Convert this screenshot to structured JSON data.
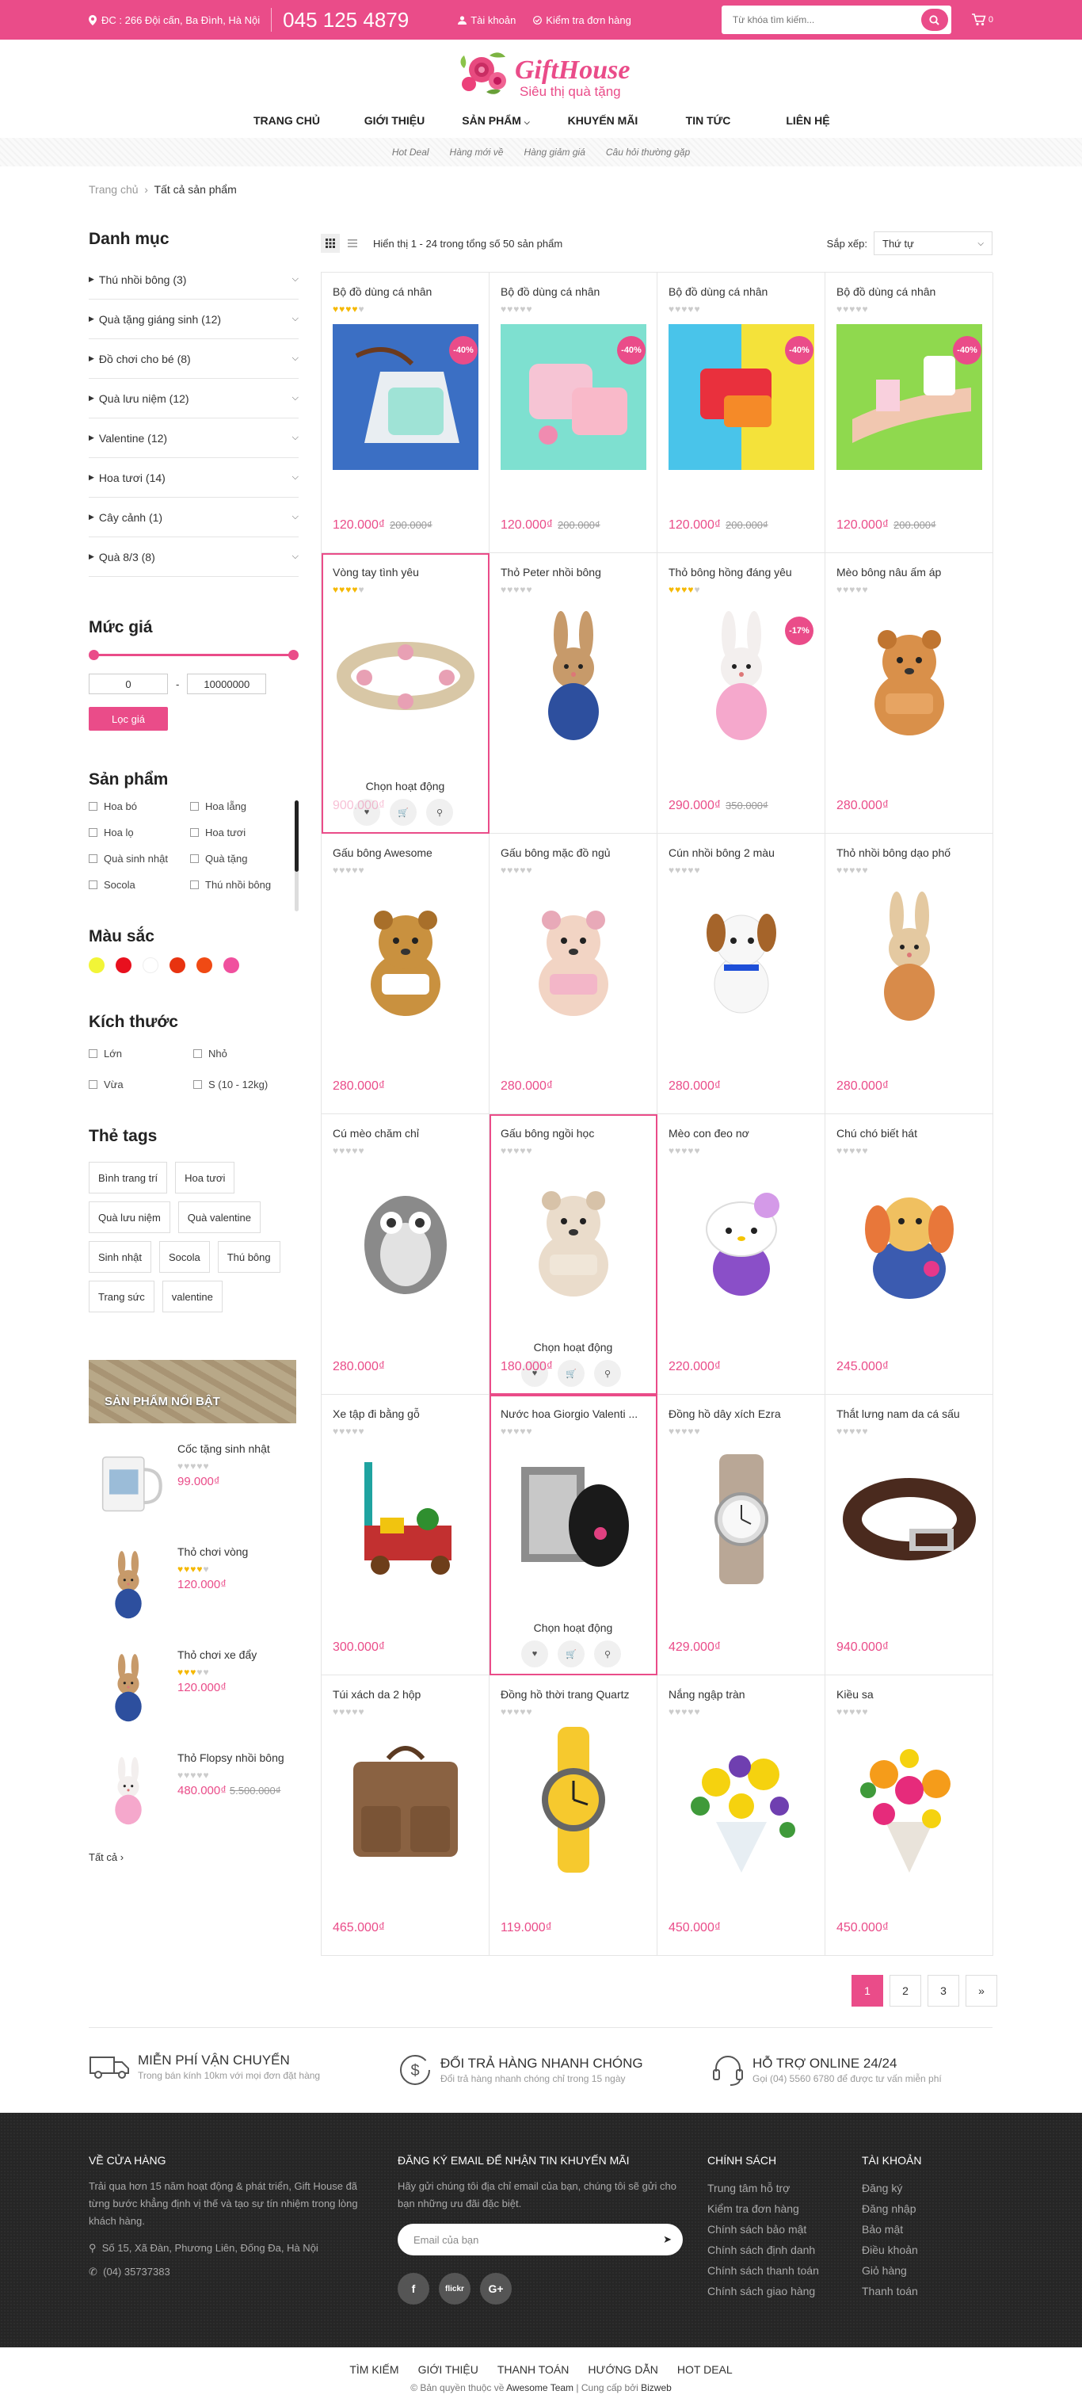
{
  "topbar": {
    "address": "ĐC : 266 Đội cấn, Ba Đình, Hà Nội",
    "phone": "045 125 4879",
    "account": "Tài khoản",
    "track_order": "Kiểm tra đơn hàng",
    "search_placeholder": "Từ khóa tìm kiếm...",
    "cart_count": "0"
  },
  "logo": {
    "title": "GiftHouse",
    "subtitle": "Siêu thị quà tặng"
  },
  "nav": [
    "TRANG CHỦ",
    "GIỚI THIỆU",
    "SẢN PHẨM",
    "KHUYẾN MÃI",
    "TIN TỨC",
    "LIÊN HỆ"
  ],
  "subnav": [
    "Hot Deal",
    "Hàng mới về",
    "Hàng giảm giá",
    "Câu hỏi thường gặp"
  ],
  "breadcrumb": {
    "home": "Trang chủ",
    "current": "Tất cả sản phẩm"
  },
  "sidebar": {
    "categories_title": "Danh mục",
    "categories": [
      "Thú nhồi bông (3)",
      "Quà tặng giáng sinh (12)",
      "Đồ chơi cho bé (8)",
      "Quà lưu niệm (12)",
      "Valentine (12)",
      "Hoa tươi (14)",
      "Cây cảnh (1)",
      "Quà 8/3 (8)"
    ],
    "price_title": "Mức giá",
    "price_min": "0",
    "price_max": "10000000",
    "filter_button": "Lọc giá",
    "products_title": "Sản phẩm",
    "product_filters": [
      "Hoa bó",
      "Hoa lẵng",
      "Hoa lọ",
      "Hoa tươi",
      "Quà sinh nhật",
      "Quà tặng",
      "Socola",
      "Thú nhồi bông"
    ],
    "colors_title": "Màu sắc",
    "colors": [
      "#f2f537",
      "#e8101e",
      "#ffffff",
      "#e83310",
      "#f04a14",
      "#f0509e"
    ],
    "sizes_title": "Kích thước",
    "sizes": [
      "Lớn",
      "Nhỏ",
      "Vừa",
      "S (10 - 12kg)"
    ],
    "tags_title": "Thẻ tags",
    "tags": [
      "Bình trang trí",
      "Hoa tươi",
      "Quà lưu niệm",
      "Quà valentine",
      "Sinh nhật",
      "Socola",
      "Thú bông",
      "Trang sức",
      "valentine"
    ],
    "featured_title": "SẢN PHẨM NỔI BẬT",
    "featured": [
      {
        "name": "Cốc tặng sinh nhật",
        "price": "99.000₫",
        "old": "",
        "stars": 0
      },
      {
        "name": "Thỏ chơi vòng",
        "price": "120.000₫",
        "old": "",
        "stars": 4
      },
      {
        "name": "Thỏ chơi xe đẩy",
        "price": "120.000₫",
        "old": "",
        "stars": 3
      },
      {
        "name": "Thỏ Flopsy nhồi bông",
        "price": "480.000₫",
        "old": "5.500.000₫",
        "stars": 0
      }
    ],
    "see_all": "Tất cả ›"
  },
  "toolbar": {
    "showing": "Hiển thị 1 - 24 trong tổng số 50 sản phẩm",
    "sort_label": "Sắp xếp:",
    "sort_value": "Thứ tự"
  },
  "products": [
    {
      "name": "Bộ đồ dùng cá nhân",
      "price": "120.000₫",
      "old": "200.000₫",
      "badge": "-40%",
      "stars": 4,
      "art": "pouch1",
      "hl": false
    },
    {
      "name": "Bộ đồ dùng cá nhân",
      "price": "120.000₫",
      "old": "200.000₫",
      "badge": "-40%",
      "stars": 0,
      "art": "pouch2",
      "hl": false
    },
    {
      "name": "Bộ đồ dùng cá nhân",
      "price": "120.000₫",
      "old": "200.000₫",
      "badge": "-40%",
      "stars": 0,
      "art": "pouch3",
      "hl": false
    },
    {
      "name": "Bộ đồ dùng cá nhân",
      "price": "120.000₫",
      "old": "200.000₫",
      "badge": "-40%",
      "stars": 0,
      "art": "pouch4",
      "hl": false
    },
    {
      "name": "Vòng tay tình yêu",
      "price": "900.000₫",
      "old": "",
      "badge": "",
      "stars": 4,
      "art": "bracelet",
      "hl": true
    },
    {
      "name": "Thỏ Peter nhồi bông",
      "price": "",
      "old": "",
      "badge": "",
      "stars": 0,
      "art": "rabbit-blue",
      "hl": false
    },
    {
      "name": "Thỏ bông hồng đáng yêu",
      "price": "290.000₫",
      "old": "350.000₫",
      "badge": "-17%",
      "stars": 4,
      "art": "rabbit-pink",
      "hl": false
    },
    {
      "name": "Mèo bông nâu ấm áp",
      "price": "280.000₫",
      "old": "",
      "badge": "",
      "stars": 0,
      "art": "cat-brown",
      "hl": false
    },
    {
      "name": "Gấu bông Awesome",
      "price": "280.000₫",
      "old": "",
      "badge": "",
      "stars": 0,
      "art": "bear-beatles",
      "hl": false
    },
    {
      "name": "Gấu bông mặc đồ ngủ",
      "price": "280.000₫",
      "old": "",
      "badge": "",
      "stars": 0,
      "art": "bear-pink",
      "hl": false
    },
    {
      "name": "Cún nhồi bông 2 màu",
      "price": "280.000₫",
      "old": "",
      "badge": "",
      "stars": 0,
      "art": "dog",
      "hl": false
    },
    {
      "name": "Thỏ nhồi bông dạo phố",
      "price": "280.000₫",
      "old": "",
      "badge": "",
      "stars": 0,
      "art": "rabbit-scarf",
      "hl": false
    },
    {
      "name": "Cú mèo chăm chỉ",
      "price": "280.000₫",
      "old": "",
      "badge": "",
      "stars": 0,
      "art": "owl",
      "hl": false
    },
    {
      "name": "Gấu bông ngồi học",
      "price": "180.000₫",
      "old": "",
      "badge": "",
      "stars": 0,
      "art": "bear-cream",
      "hl": true
    },
    {
      "name": "Mèo con đeo nơ",
      "price": "220.000₫",
      "old": "",
      "badge": "",
      "stars": 0,
      "art": "kitty",
      "hl": false
    },
    {
      "name": "Chú chó biết hát",
      "price": "245.000₫",
      "old": "",
      "badge": "",
      "stars": 0,
      "art": "puppy",
      "hl": false
    },
    {
      "name": "Xe tập đi bằng gỗ",
      "price": "300.000₫",
      "old": "",
      "badge": "",
      "stars": 0,
      "art": "walker",
      "hl": false
    },
    {
      "name": "Nước hoa Giorgio Valenti ...",
      "price": "",
      "old": "",
      "badge": "",
      "stars": 0,
      "art": "perfume",
      "hl": true
    },
    {
      "name": "Đồng hồ dây xích Ezra",
      "price": "429.000₫",
      "old": "",
      "badge": "",
      "stars": 0,
      "art": "watch-wrap",
      "hl": false
    },
    {
      "name": "Thắt lưng nam da cá sấu",
      "price": "940.000₫",
      "old": "",
      "badge": "",
      "stars": 0,
      "art": "belt",
      "hl": false
    },
    {
      "name": "Túi xách da 2 hộp",
      "price": "465.000₫",
      "old": "",
      "badge": "",
      "stars": 0,
      "art": "bag",
      "hl": false
    },
    {
      "name": "Đồng hồ thời trang Quartz",
      "price": "119.000₫",
      "old": "",
      "badge": "",
      "stars": 0,
      "art": "watch-yellow",
      "hl": false
    },
    {
      "name": "Nắng ngập tràn",
      "price": "450.000₫",
      "old": "",
      "badge": "",
      "stars": 0,
      "art": "flowers1",
      "hl": false
    },
    {
      "name": "Kiều sa",
      "price": "450.000₫",
      "old": "",
      "badge": "",
      "stars": 0,
      "art": "flowers2",
      "hl": false
    }
  ],
  "hover_label": "Chọn hoạt động",
  "pagination": [
    "1",
    "2",
    "3",
    "»"
  ],
  "services": [
    {
      "title": "MIỄN PHÍ VẬN CHUYỂN",
      "desc": "Trong bán kính 10km với mọi đơn đặt hàng",
      "icon": "truck-icon"
    },
    {
      "title": "ĐỔI TRẢ HÀNG NHANH CHÓNG",
      "desc": "Đổi trả hàng nhanh chóng chỉ trong 15 ngày",
      "icon": "dollar-icon"
    },
    {
      "title": "HỖ TRỢ ONLINE 24/24",
      "desc": "Gọi (04) 5560 6780 để được tư vấn miễn phí",
      "icon": "headset-icon"
    }
  ],
  "footer": {
    "about_title": "VỀ CỬA HÀNG",
    "about_text": "Trải qua hơn 15 năm hoạt động & phát triển, Gift House đã từng bước khẳng định vị thế và tạo sự tín nhiệm trong lòng khách hàng.",
    "address": "Số 15, Xã Đàn, Phương Liên, Đống Đa, Hà Nội",
    "phone": "(04) 35737383",
    "newsletter_title": "ĐĂNG KÝ EMAIL ĐỂ NHẬN TIN KHUYẾN MÃI",
    "newsletter_text": "Hãy gửi chúng tôi địa chỉ email của bạn, chúng tôi sẽ gửi cho bạn những ưu đãi đặc biệt.",
    "email_placeholder": "Email của bạn",
    "socials": [
      "f",
      "flickr",
      "G+"
    ],
    "policy_title": "CHÍNH SÁCH",
    "policy_links": [
      "Trung tâm hỗ trợ",
      "Kiểm tra đơn hàng",
      "Chính sách bảo mật",
      "Chính sách định danh",
      "Chính sách thanh toán",
      "Chính sách giao hàng"
    ],
    "account_title": "TÀI KHOẢN",
    "account_links": [
      "Đăng ký",
      "Đăng nhập",
      "Bảo mật",
      "Điều khoản",
      "Giỏ hàng",
      "Thanh toán"
    ]
  },
  "bottom": {
    "nav": [
      "TÌM KIẾM",
      "GIỚI THIỆU",
      "THANH TOÁN",
      "HƯỚNG DẪN",
      "HOT DEAL"
    ],
    "copy_prefix": "© Bản quyền thuộc về",
    "copy_team": "Awesome Team",
    "copy_mid": "| Cung cấp bởi",
    "copy_brand": "Bizweb"
  }
}
